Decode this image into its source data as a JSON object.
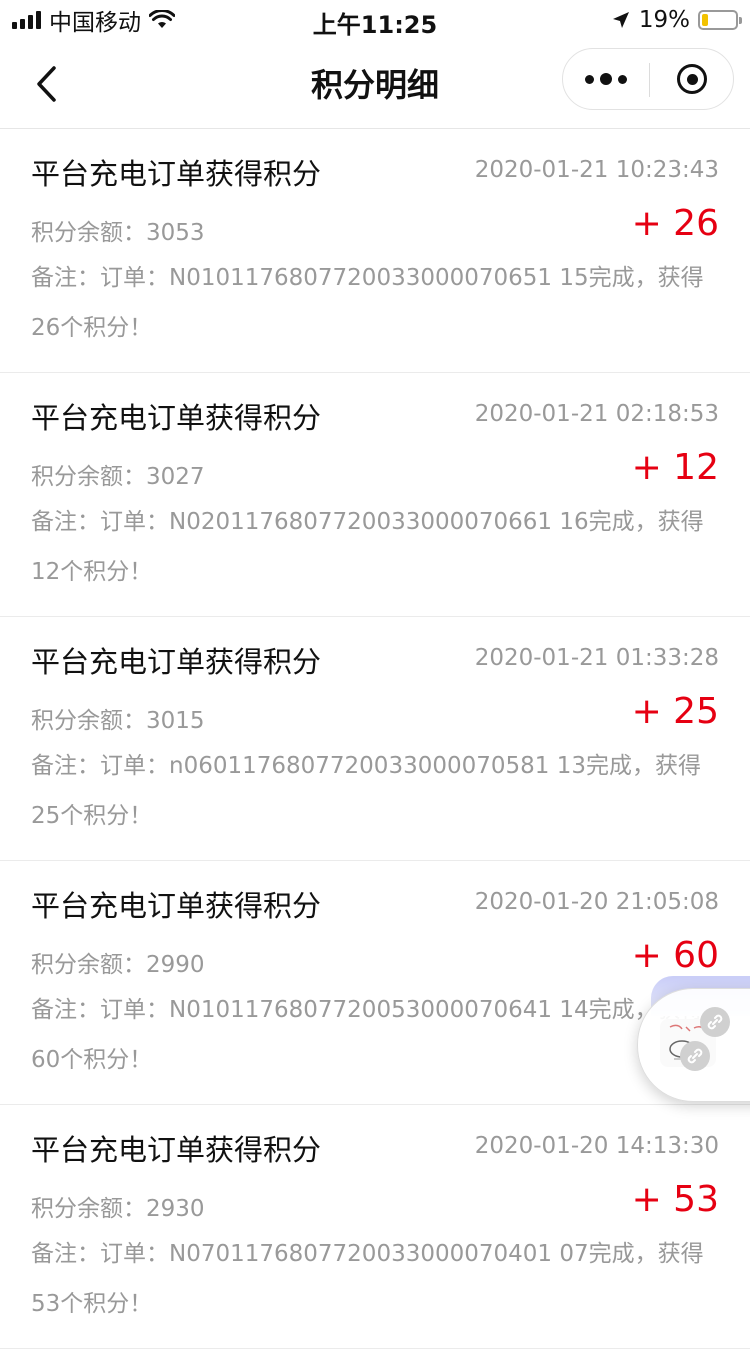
{
  "status_bar": {
    "carrier": "中国移动",
    "time": "上午11:25",
    "battery_percent": "19%",
    "battery_level": 0.19
  },
  "nav": {
    "title": "积分明细"
  },
  "colors": {
    "delta_red": "#e60012",
    "muted_text": "#999999",
    "battery_yellow": "#f2c200"
  },
  "records": [
    {
      "title": "平台充电订单获得积分",
      "time": "2020-01-21 10:23:43",
      "balance": "积分余额：3053",
      "delta": "+ 26",
      "note": "备注：订单：N0101176807720033000070651 15完成，获得26个积分！"
    },
    {
      "title": "平台充电订单获得积分",
      "time": "2020-01-21 02:18:53",
      "balance": "积分余额：3027",
      "delta": "+ 12",
      "note": "备注：订单：N0201176807720033000070661 16完成，获得12个积分！"
    },
    {
      "title": "平台充电订单获得积分",
      "time": "2020-01-21 01:33:28",
      "balance": "积分余额：3015",
      "delta": "+ 25",
      "note": "备注：订单：n0601176807720033000070581 13完成，获得25个积分！"
    },
    {
      "title": "平台充电订单获得积分",
      "time": "2020-01-20 21:05:08",
      "balance": "积分余额：2990",
      "delta": "+ 60",
      "note": "备注：订单：N0101176807720053000070641 14完成，获得60个积分！"
    },
    {
      "title": "平台充电订单获得积分",
      "time": "2020-01-20 14:13:30",
      "balance": "积分余额：2930",
      "delta": "+ 53",
      "note": "备注：订单：N0701176807720033000070401 07完成，获得53个积分！"
    }
  ]
}
